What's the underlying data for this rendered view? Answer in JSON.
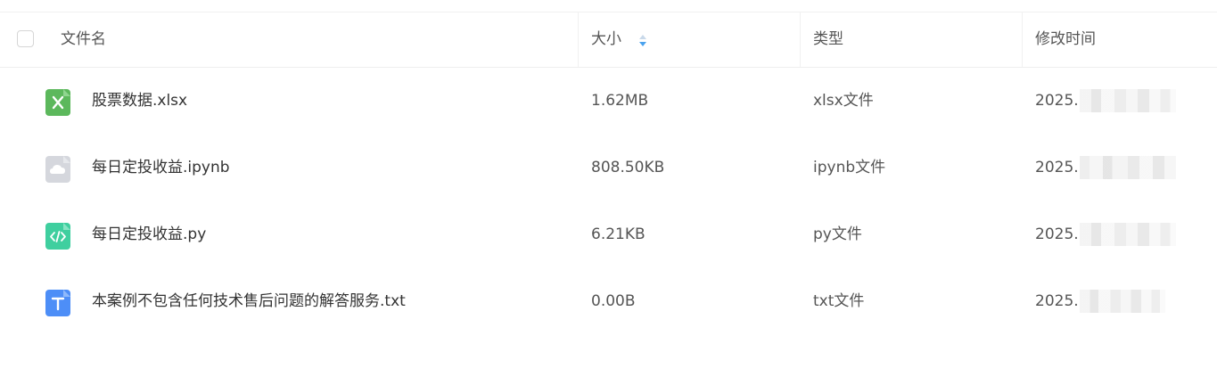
{
  "header": {
    "name_label": "文件名",
    "size_label": "大小",
    "type_label": "类型",
    "mtime_label": "修改时间"
  },
  "files": [
    {
      "name": "股票数据.xlsx",
      "size": "1.62MB",
      "type": "xlsx文件",
      "mtime": "2025.",
      "icon": "excel-file-icon",
      "icon_color": "#5cb85c"
    },
    {
      "name": "每日定投收益.ipynb",
      "size": "808.50KB",
      "type": "ipynb文件",
      "mtime": "2025.",
      "icon": "cloud-file-icon",
      "icon_color": "#d5d7dd"
    },
    {
      "name": "每日定投收益.py",
      "size": "6.21KB",
      "type": "py文件",
      "mtime": "2025.",
      "icon": "code-file-icon",
      "icon_color": "#3fcf9f"
    },
    {
      "name": "本案例不包含任何技术售后问题的解答服务.txt",
      "size": "0.00B",
      "type": "txt文件",
      "mtime": "2025.",
      "icon": "text-file-icon",
      "icon_color": "#4d8ef7"
    }
  ],
  "colors": {
    "sort_active": "#4aa2ee",
    "sort_inactive": "#c9d9ea"
  }
}
